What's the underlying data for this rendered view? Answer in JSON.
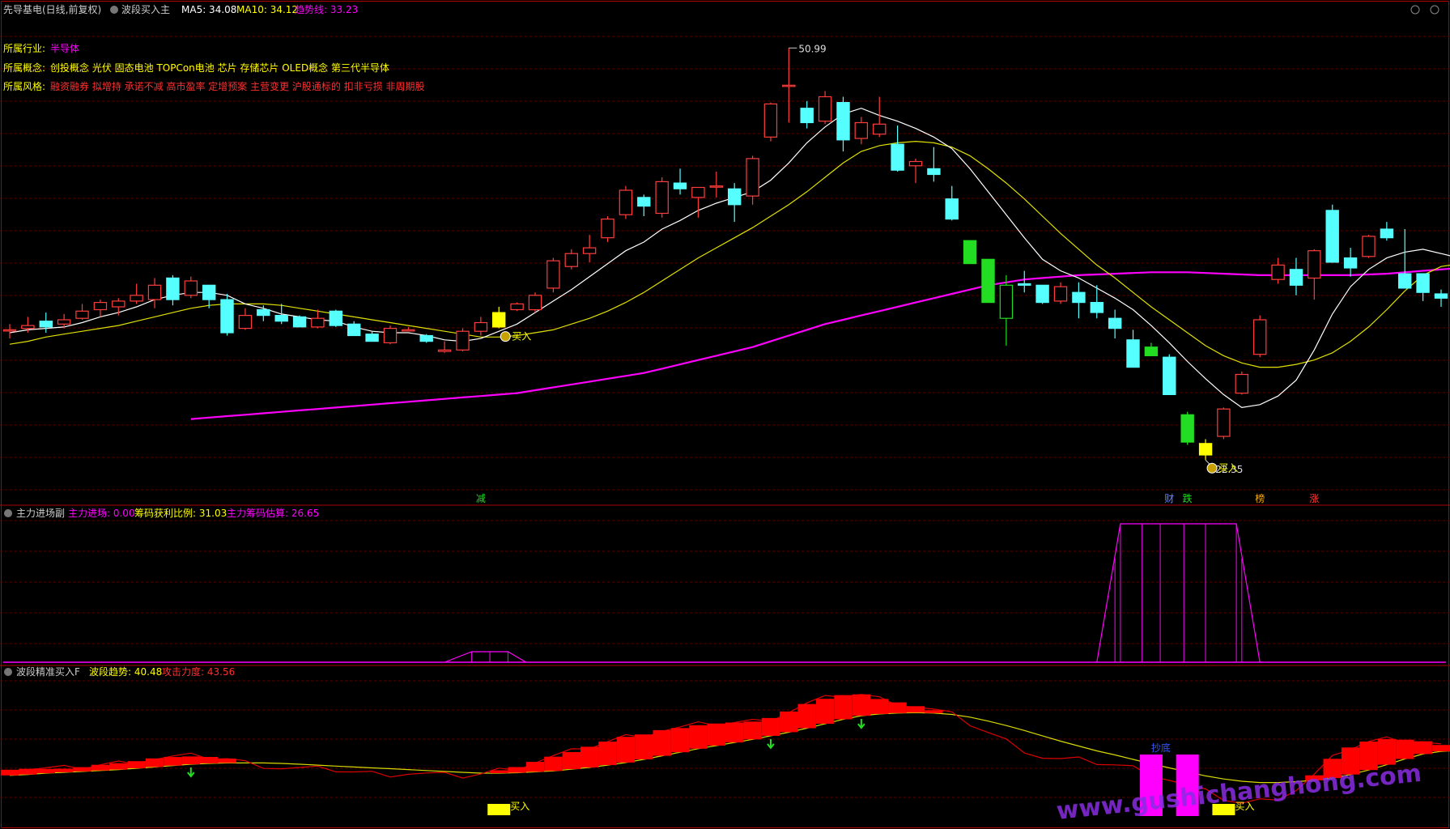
{
  "colors": {
    "background": "#000000",
    "grid": "#5a0000",
    "frame": "#b00000",
    "up": "#ff3c3c",
    "down": "#55ffff",
    "green": "#22dd22",
    "yellow": "#ffff00",
    "magenta": "#ff00ff",
    "ma5": "#ffffff",
    "ma10": "#e0e000",
    "trend": "#ff00ff"
  },
  "main_panel": {
    "title": "先导基电(日线,前复权)",
    "indicator_name": "波段买入主",
    "ma5_label": "MA5: 34.08",
    "ma10_label": "MA10: 34.12",
    "trend_label": "趋势线: 33.23",
    "industry_label": "所属行业:",
    "industry_value": "半导体",
    "concept_label": "所属概念:",
    "concept_value": "创投概念 光伏 固态电池 TOPCon电池 芯片 存储芯片 OLED概念 第三代半导体",
    "style_label": "所属风格:",
    "style_value": "融资融券 拟增持 承诺不减 高市盈率 定增预案 主营变更 沪股通标的 扣非亏损 非周期股",
    "high_mark": "50.99",
    "low_mark": "22.35",
    "buy_text": "买入",
    "bottom_tags": [
      {
        "text": "减",
        "color": "#22dd22"
      },
      {
        "text": "财",
        "color": "#6688ff"
      },
      {
        "text": "跌",
        "color": "#22dd22"
      },
      {
        "text": "榜",
        "color": "#ffaa00"
      },
      {
        "text": "涨",
        "color": "#ff3c3c"
      }
    ]
  },
  "sub_panel_1": {
    "name": "主力进场副",
    "label_1": "主力进场: 0.00",
    "label_2": "筹码获利比例: 31.03",
    "label_3": "主力筹码估算: 26.65"
  },
  "sub_panel_2": {
    "name": "波段精准买入F",
    "label_1": "波段趋势: 40.48",
    "label_2": "攻击力度: 43.56",
    "bottom_text": "抄底",
    "buy_text": "买入"
  },
  "watermark": "www.gushichanghong.com",
  "chart_data": {
    "type": "candlestick",
    "candles": [
      {
        "o": 31.4,
        "h": 31.8,
        "l": 30.8,
        "c": 31.4
      },
      {
        "o": 31.5,
        "h": 32.3,
        "l": 31.2,
        "c": 31.7
      },
      {
        "o": 32.0,
        "h": 32.6,
        "l": 31.2,
        "c": 31.6
      },
      {
        "o": 31.8,
        "h": 32.5,
        "l": 31.5,
        "c": 32.1
      },
      {
        "o": 32.2,
        "h": 33.2,
        "l": 32.1,
        "c": 32.7
      },
      {
        "o": 32.8,
        "h": 33.5,
        "l": 32.3,
        "c": 33.3
      },
      {
        "o": 33.0,
        "h": 33.6,
        "l": 32.4,
        "c": 33.4
      },
      {
        "o": 33.4,
        "h": 34.6,
        "l": 33.2,
        "c": 33.8
      },
      {
        "o": 33.5,
        "h": 35.0,
        "l": 32.9,
        "c": 34.5
      },
      {
        "o": 35.0,
        "h": 35.2,
        "l": 33.1,
        "c": 33.5
      },
      {
        "o": 33.8,
        "h": 35.1,
        "l": 33.6,
        "c": 34.8
      },
      {
        "o": 34.5,
        "h": 34.5,
        "l": 32.9,
        "c": 33.5
      },
      {
        "o": 33.5,
        "h": 33.9,
        "l": 31.0,
        "c": 31.2
      },
      {
        "o": 31.5,
        "h": 32.9,
        "l": 31.4,
        "c": 32.4
      },
      {
        "o": 32.8,
        "h": 33.1,
        "l": 32.0,
        "c": 32.4
      },
      {
        "o": 32.4,
        "h": 33.2,
        "l": 31.8,
        "c": 32.0
      },
      {
        "o": 32.3,
        "h": 32.4,
        "l": 31.6,
        "c": 31.6
      },
      {
        "o": 31.6,
        "h": 32.8,
        "l": 31.5,
        "c": 32.2
      },
      {
        "o": 32.7,
        "h": 32.8,
        "l": 31.6,
        "c": 31.7
      },
      {
        "o": 31.8,
        "h": 32.0,
        "l": 31.0,
        "c": 31.0
      },
      {
        "o": 31.1,
        "h": 31.3,
        "l": 30.6,
        "c": 30.6
      },
      {
        "o": 30.5,
        "h": 31.7,
        "l": 30.4,
        "c": 31.5
      },
      {
        "o": 31.4,
        "h": 31.6,
        "l": 31.3,
        "c": 31.4
      },
      {
        "o": 31.0,
        "h": 31.1,
        "l": 30.5,
        "c": 30.6
      },
      {
        "o": 29.9,
        "h": 30.6,
        "l": 29.8,
        "c": 30.0
      },
      {
        "o": 30.0,
        "h": 31.5,
        "l": 29.9,
        "c": 31.3
      },
      {
        "o": 31.3,
        "h": 32.3,
        "l": 31.0,
        "c": 31.9
      },
      {
        "o": 31.6,
        "h": 33.0,
        "l": 31.5,
        "c": 32.6
      },
      {
        "o": 32.8,
        "h": 33.3,
        "l": 32.7,
        "c": 33.2
      },
      {
        "o": 32.8,
        "h": 34.0,
        "l": 32.6,
        "c": 33.8
      },
      {
        "o": 34.3,
        "h": 36.4,
        "l": 34.0,
        "c": 36.2
      },
      {
        "o": 35.8,
        "h": 37.0,
        "l": 35.6,
        "c": 36.7
      },
      {
        "o": 36.7,
        "h": 38.0,
        "l": 36.1,
        "c": 37.1
      },
      {
        "o": 37.8,
        "h": 39.3,
        "l": 37.5,
        "c": 39.1
      },
      {
        "o": 39.4,
        "h": 41.4,
        "l": 39.1,
        "c": 41.1
      },
      {
        "o": 40.6,
        "h": 40.8,
        "l": 39.3,
        "c": 40.0
      },
      {
        "o": 39.5,
        "h": 42.0,
        "l": 39.2,
        "c": 41.7
      },
      {
        "o": 41.6,
        "h": 42.6,
        "l": 40.8,
        "c": 41.2
      },
      {
        "o": 40.6,
        "h": 41.3,
        "l": 39.2,
        "c": 41.3
      },
      {
        "o": 41.4,
        "h": 42.4,
        "l": 40.6,
        "c": 41.4
      },
      {
        "o": 41.2,
        "h": 41.6,
        "l": 38.9,
        "c": 40.1
      },
      {
        "o": 40.7,
        "h": 43.5,
        "l": 40.1,
        "c": 43.3
      },
      {
        "o": 44.8,
        "h": 47.2,
        "l": 44.5,
        "c": 47.1
      },
      {
        "o": 48.4,
        "h": 50.99,
        "l": 45.8,
        "c": 48.4
      },
      {
        "o": 46.8,
        "h": 47.3,
        "l": 45.4,
        "c": 45.8
      },
      {
        "o": 45.9,
        "h": 48.0,
        "l": 45.7,
        "c": 47.6
      },
      {
        "o": 47.2,
        "h": 47.6,
        "l": 43.8,
        "c": 44.6
      },
      {
        "o": 44.7,
        "h": 46.2,
        "l": 44.3,
        "c": 45.8
      },
      {
        "o": 45.0,
        "h": 47.6,
        "l": 44.8,
        "c": 45.7
      },
      {
        "o": 44.3,
        "h": 45.6,
        "l": 42.4,
        "c": 42.5
      },
      {
        "o": 42.8,
        "h": 43.3,
        "l": 41.6,
        "c": 43.1
      },
      {
        "o": 42.6,
        "h": 44.1,
        "l": 41.7,
        "c": 42.2
      },
      {
        "o": 40.5,
        "h": 41.4,
        "l": 39.0,
        "c": 39.1
      },
      {
        "o": 37.6,
        "h": 37.6,
        "l": 36.0,
        "c": 36.0
      },
      {
        "o": 36.3,
        "h": 36.3,
        "l": 33.3,
        "c": 33.3
      },
      {
        "o": 32.2,
        "h": 35.2,
        "l": 30.3,
        "c": 34.5
      },
      {
        "o": 34.6,
        "h": 35.5,
        "l": 34.0,
        "c": 34.5
      },
      {
        "o": 34.5,
        "h": 34.5,
        "l": 33.2,
        "c": 33.3
      },
      {
        "o": 33.4,
        "h": 34.7,
        "l": 33.2,
        "c": 34.4
      },
      {
        "o": 34.0,
        "h": 34.7,
        "l": 32.2,
        "c": 33.3
      },
      {
        "o": 33.3,
        "h": 34.5,
        "l": 32.2,
        "c": 32.6
      },
      {
        "o": 32.2,
        "h": 32.8,
        "l": 30.8,
        "c": 31.5
      },
      {
        "o": 30.7,
        "h": 31.4,
        "l": 29.0,
        "c": 28.8
      },
      {
        "o": 30.2,
        "h": 30.5,
        "l": 29.9,
        "c": 29.6
      },
      {
        "o": 29.5,
        "h": 29.7,
        "l": 26.9,
        "c": 26.9
      },
      {
        "o": 25.5,
        "h": 25.7,
        "l": 23.4,
        "c": 23.6
      },
      {
        "o": 22.7,
        "h": 23.8,
        "l": 22.35,
        "c": 23.5
      },
      {
        "o": 24.0,
        "h": 26.0,
        "l": 23.8,
        "c": 25.9
      },
      {
        "o": 27.0,
        "h": 28.5,
        "l": 26.9,
        "c": 28.3
      },
      {
        "o": 29.7,
        "h": 32.4,
        "l": 29.5,
        "c": 32.1
      },
      {
        "o": 34.9,
        "h": 36.4,
        "l": 34.6,
        "c": 35.9
      },
      {
        "o": 35.6,
        "h": 36.4,
        "l": 33.8,
        "c": 34.5
      },
      {
        "o": 35.0,
        "h": 37.0,
        "l": 33.5,
        "c": 36.9
      },
      {
        "o": 39.7,
        "h": 40.1,
        "l": 36.1,
        "c": 36.1
      },
      {
        "o": 36.4,
        "h": 37.1,
        "l": 35.1,
        "c": 35.7
      },
      {
        "o": 36.5,
        "h": 38.0,
        "l": 36.4,
        "c": 37.9
      },
      {
        "o": 38.4,
        "h": 38.9,
        "l": 37.6,
        "c": 37.8
      },
      {
        "o": 35.3,
        "h": 38.4,
        "l": 34.5,
        "c": 34.3
      },
      {
        "o": 35.3,
        "h": 35.3,
        "l": 33.4,
        "c": 34.0
      },
      {
        "o": 33.9,
        "h": 34.2,
        "l": 33.0,
        "c": 33.6
      }
    ],
    "ma5": [
      31.2,
      31.4,
      31.5,
      31.6,
      31.9,
      32.3,
      32.6,
      33.0,
      33.5,
      33.8,
      34.0,
      34.0,
      33.8,
      33.2,
      32.9,
      32.5,
      32.3,
      32.1,
      32.0,
      31.6,
      31.3,
      31.2,
      31.2,
      31.0,
      30.7,
      30.6,
      30.8,
      31.3,
      31.8,
      32.6,
      33.4,
      34.2,
      35.1,
      36.0,
      36.9,
      37.5,
      38.4,
      39.0,
      39.7,
      40.2,
      40.6,
      41.0,
      41.8,
      43.0,
      44.4,
      45.5,
      46.4,
      46.8,
      46.3,
      45.9,
      45.4,
      44.8,
      44.0,
      42.6,
      41.0,
      39.4,
      37.8,
      36.3,
      35.5,
      35.0,
      34.3,
      33.6,
      32.8,
      31.7,
      30.5,
      29.2,
      28.0,
      26.9,
      26.0,
      26.2,
      26.8,
      27.9,
      30.0,
      32.5,
      34.4,
      35.6,
      36.4,
      36.8,
      37.0,
      36.7,
      36.4,
      36.1,
      35.8
    ],
    "ma10": [
      30.4,
      30.6,
      30.9,
      31.1,
      31.3,
      31.5,
      31.7,
      32.0,
      32.3,
      32.6,
      32.9,
      33.1,
      33.2,
      33.2,
      33.2,
      33.1,
      32.9,
      32.7,
      32.5,
      32.3,
      32.1,
      31.9,
      31.7,
      31.5,
      31.3,
      31.1,
      30.9,
      30.9,
      31.0,
      31.2,
      31.4,
      31.8,
      32.2,
      32.7,
      33.3,
      34.0,
      34.8,
      35.6,
      36.4,
      37.1,
      37.8,
      38.5,
      39.3,
      40.1,
      41.0,
      42.0,
      43.0,
      43.8,
      44.2,
      44.4,
      44.5,
      44.4,
      44.1,
      43.5,
      42.6,
      41.6,
      40.5,
      39.3,
      38.1,
      37.0,
      35.9,
      35.0,
      34.0,
      33.0,
      32.1,
      31.2,
      30.3,
      29.6,
      29.1,
      28.8,
      28.8,
      29.0,
      29.3,
      29.8,
      30.6,
      31.6,
      32.8,
      34.1,
      35.2,
      35.8,
      36.0,
      36.1,
      36.2
    ],
    "trend": [
      null,
      null,
      null,
      null,
      null,
      null,
      null,
      null,
      null,
      null,
      25.2,
      25.3,
      25.4,
      25.5,
      25.6,
      25.7,
      25.8,
      25.9,
      26.0,
      26.1,
      26.2,
      26.3,
      26.4,
      26.5,
      26.6,
      26.7,
      26.8,
      26.9,
      27.0,
      27.2,
      27.4,
      27.6,
      27.8,
      28.0,
      28.2,
      28.4,
      28.7,
      29.0,
      29.3,
      29.6,
      29.9,
      30.2,
      30.6,
      31.0,
      31.4,
      31.8,
      32.1,
      32.4,
      32.7,
      33.0,
      33.3,
      33.6,
      33.9,
      34.2,
      34.5,
      34.7,
      34.9,
      35.0,
      35.1,
      35.2,
      35.25,
      35.3,
      35.35,
      35.4,
      35.4,
      35.4,
      35.35,
      35.3,
      35.25,
      35.2,
      35.2,
      35.2,
      35.2,
      35.2,
      35.2,
      35.25,
      35.3,
      35.4,
      35.5,
      35.6,
      35.7,
      35.8,
      35.9
    ],
    "buy_signals": [
      27,
      66
    ],
    "ylim": [
      20.0,
      53.2
    ]
  }
}
